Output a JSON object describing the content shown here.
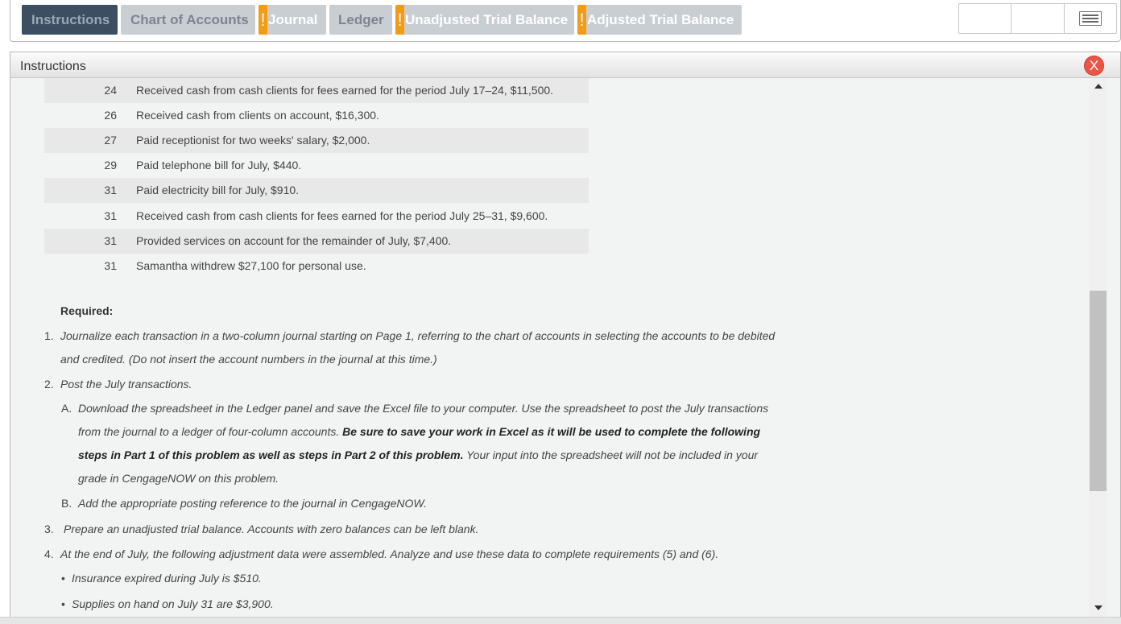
{
  "tabs": [
    {
      "label": "Instructions",
      "active": true,
      "warning": false
    },
    {
      "label": "Chart of Accounts",
      "active": false,
      "warning": false
    },
    {
      "label": "Journal",
      "active": false,
      "warning": true
    },
    {
      "label": "Ledger",
      "active": false,
      "warning": false
    },
    {
      "label": "Unadjusted Trial Balance",
      "active": false,
      "warning": true
    },
    {
      "label": "Adjusted Trial Balance",
      "active": false,
      "warning": true
    }
  ],
  "warning_mark": "!",
  "panel": {
    "title": "Instructions",
    "close_label": "X"
  },
  "transactions": [
    {
      "day": "24",
      "text": "Received cash from cash clients for fees earned for the period July 17–24, $11,500."
    },
    {
      "day": "26",
      "text": "Received cash from clients on account, $16,300."
    },
    {
      "day": "27",
      "text": "Paid receptionist for two weeks' salary, $2,000."
    },
    {
      "day": "29",
      "text": "Paid telephone bill for July, $440."
    },
    {
      "day": "31",
      "text": "Paid electricity bill for July, $910."
    },
    {
      "day": "31",
      "text": "Received cash from cash clients for fees earned for the period July 25–31, $9,600."
    },
    {
      "day": "31",
      "text": "Provided services on account for the remainder of July, $7,400."
    },
    {
      "day": "31",
      "text": "Samantha withdrew $27,100 for personal use."
    }
  ],
  "required": {
    "label": "Required:",
    "item1": {
      "num": "1.",
      "line1": "Journalize each transaction in a two-column journal starting on Page 1, referring to the chart of accounts in selecting the accounts to be debited",
      "line2": "and credited. (Do not insert the account numbers in the journal at this time.)"
    },
    "item2": {
      "num": "2.",
      "text": "Post the July transactions."
    },
    "item2a": {
      "num": "A.",
      "line1": "Download the spreadsheet in the Ledger panel and save the Excel file to your computer. Use the spreadsheet to post the July transactions",
      "line2_plain": "from the journal to a ledger of four-column accounts.",
      "line2_bold": "Be sure to save your work in Excel as it will be used to complete the following",
      "line3_bold": "steps in Part 1 of this problem as well as steps in Part 2 of this problem.",
      "line3_plain": "Your input into the spreadsheet will not be included in your",
      "line4": "grade in CengageNOW on this problem."
    },
    "item2b": {
      "num": "B.",
      "text": "Add the appropriate posting reference to the journal in CengageNOW."
    },
    "item3": {
      "num": "3.",
      "text": "Prepare an unadjusted trial balance. Accounts with zero balances can be left blank."
    },
    "item4": {
      "num": "4.",
      "text": "At the end of July, the following adjustment data were assembled. Analyze and use these data to complete requirements (5) and (6)."
    },
    "bullets": [
      "Insurance expired during July is $510.",
      "Supplies on hand on July 31 are $3,900."
    ],
    "bullet_mark": "•"
  },
  "colors": {
    "active_tab": "#3b4e62",
    "tab": "#c9ced3",
    "warning": "#f39c12",
    "close": "#e8564a",
    "panel_bg": "#f2f4f4"
  }
}
